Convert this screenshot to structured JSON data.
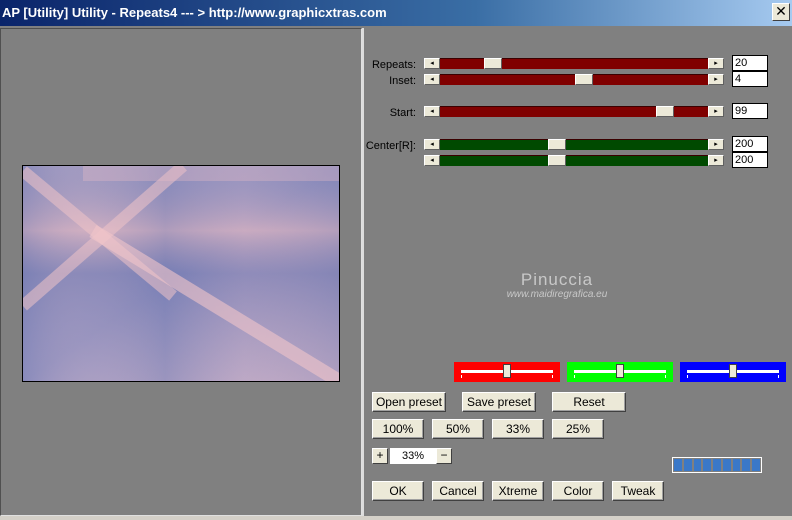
{
  "window": {
    "title": "AP [Utility]  Utility - Repeats4     --- > http://www.graphicxtras.com",
    "close_glyph": "✕"
  },
  "controls": {
    "repeats": {
      "label": "Repeats:",
      "value": "20",
      "position": 0.18,
      "color": "#800000"
    },
    "inset": {
      "label": "Inset:",
      "value": "4",
      "position": 0.53,
      "color": "#800000"
    },
    "start": {
      "label": "Start:",
      "value": "99",
      "position": 0.85,
      "color": "#800000"
    },
    "center_x": {
      "label": "Center[R]:",
      "value": "200",
      "position": 0.43,
      "color": "#004a00"
    },
    "center_y": {
      "label": "",
      "value": "200",
      "position": 0.43,
      "color": "#004a00"
    },
    "arrow_left_glyph": "◂",
    "arrow_right_glyph": "▸"
  },
  "watermark": {
    "name": "Pinuccia",
    "url": "www.maidiregrafica.eu"
  },
  "color_sliders": [
    {
      "name": "red",
      "color": "#ff0000",
      "position": 0.5
    },
    {
      "name": "green",
      "color": "#00ff00",
      "position": 0.5
    },
    {
      "name": "blue",
      "color": "#0000ff",
      "position": 0.5
    }
  ],
  "buttons": {
    "open_preset": "Open preset",
    "save_preset": "Save preset",
    "reset": "Reset",
    "zoom_100": "100%",
    "zoom_50": "50%",
    "zoom_33": "33%",
    "zoom_25": "25%",
    "zoom_in": "+",
    "zoom_out": "−",
    "ok": "OK",
    "cancel": "Cancel",
    "xtreme": "Xtreme",
    "color": "Color",
    "tweak": "Tweak"
  },
  "zoom": {
    "current": "33%"
  },
  "progress": {
    "segments": 9,
    "fraction": 1.0,
    "color": "#3a78c8"
  },
  "preview": {
    "colors": {
      "blue": "#6f78b0",
      "pink": "#e7b8bf",
      "lavender": "#b0a4c4"
    }
  }
}
